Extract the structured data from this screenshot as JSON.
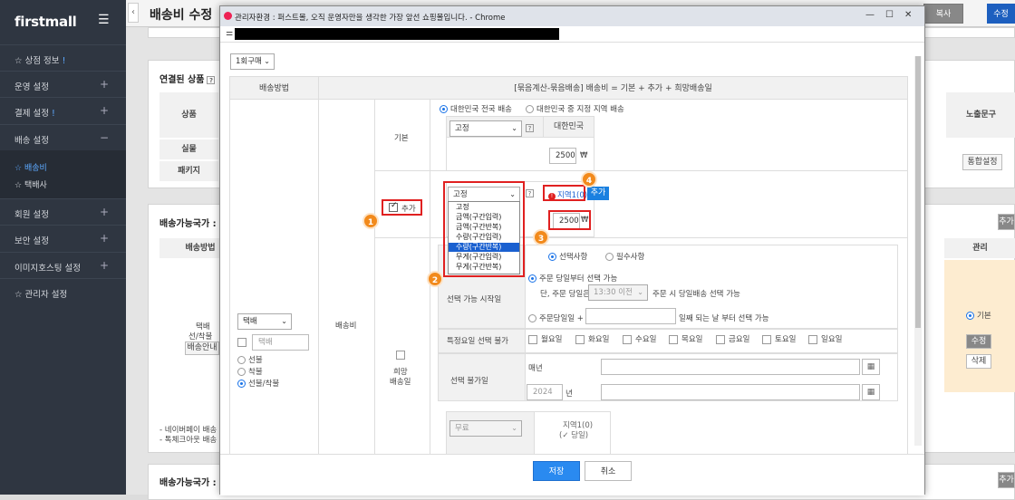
{
  "sidebar": {
    "logo": "firstmall",
    "items": [
      {
        "label": "상점 정보",
        "mark": "!"
      },
      {
        "label": "운영 설정"
      },
      {
        "label": "결제 설정",
        "mark": "!"
      },
      {
        "label": "배송 설정"
      }
    ],
    "sub_items": [
      "배송비",
      "택배사"
    ],
    "items2": [
      "회원 설정",
      "보안 설정",
      "이미지호스팅 설정",
      "관리자 설정"
    ]
  },
  "page": {
    "title": "배송비 수정",
    "copy_button": "복사",
    "save_button_partial": "수정",
    "linked_title": "연결된 상품",
    "th_product": "상품",
    "th_expose": "노출문구",
    "row_real": "실물",
    "row_package": "패키지",
    "btn_total": "통합설정",
    "avail_title": "배송가능국가 : 대",
    "avail_title2": "배송가능국가 : 해",
    "th_method": "배송방법",
    "th_manage": "관리",
    "partial_left1": "택배",
    "partial_left2": "선/착불",
    "partial_left3": "배송안내",
    "radio_default": "기본",
    "btn_edit": "수정",
    "btn_delete": "삭제",
    "note1": "- 네이버페이 배송",
    "note2": "- 톡체크아웃 배송",
    "add_btn": "추가"
  },
  "popup": {
    "window_title": "관리자환경 : 퍼스트몰, 오직 운영자만을 생각한 가장 앞선 쇼핑몰입니다. - Chrome",
    "order_select": "1회구매",
    "head_method": "배송방법",
    "head_formula": "[묶음계산-묶음배송] 배송비 = 기본 + 추가 + 희망배송일",
    "method_select": "택배",
    "method_input_placeholder": "택배",
    "method_radios": [
      "선불",
      "착불",
      "선불/착불"
    ],
    "method_radio_selected": 2,
    "fee_label": "배송비",
    "basic_label": "기본",
    "region_radios": [
      "대한민국 전국 배송",
      "대한민국 중 지정 지역 배송"
    ],
    "fixed_select": "고정",
    "korea_label": "대한민국",
    "basic_amount": "2500",
    "currency": "₩",
    "add_label": "추가",
    "add_select": "고정",
    "dropdown_options": [
      "고정",
      "금액(구간입력)",
      "금액(구간반복)",
      "수량(구간입력)",
      "수량(구간반복)",
      "무게(구간입력)",
      "무게(구간반복)"
    ],
    "dropdown_highlighted": 4,
    "region_link": "지역1(0)",
    "add_button": "추가",
    "add_amount": "2500",
    "hope_label": "희망",
    "hope_label2": "배송일",
    "choice_radios": [
      "선택사항",
      "필수사항"
    ],
    "start_label": "선택 가능 시작일",
    "start_opt1": "주문 당일부터 선택 가능",
    "start_opt1_detail_a": "단, 주문 당일은",
    "start_time": "13:30 이전",
    "start_opt1_detail_b": "주문 시 당일배송 선택 가능",
    "start_opt2_a": "주문당일일 +",
    "start_opt2_b": "일째 되는 날 부터 선택 가능",
    "weekday_label": "특정요일 선택 불가",
    "weekdays": [
      "월요일",
      "화요일",
      "수요일",
      "목요일",
      "금요일",
      "토요일",
      "일요일"
    ],
    "blocked_label": "선택 불가일",
    "every_year": "매년",
    "year_value": "2024",
    "year_unit": "년",
    "free_select": "무료",
    "region_text": "지역1(0)",
    "sameday_text": "당일",
    "save": "저장",
    "cancel": "취소"
  },
  "annotations": [
    "1",
    "2",
    "3",
    "4"
  ]
}
